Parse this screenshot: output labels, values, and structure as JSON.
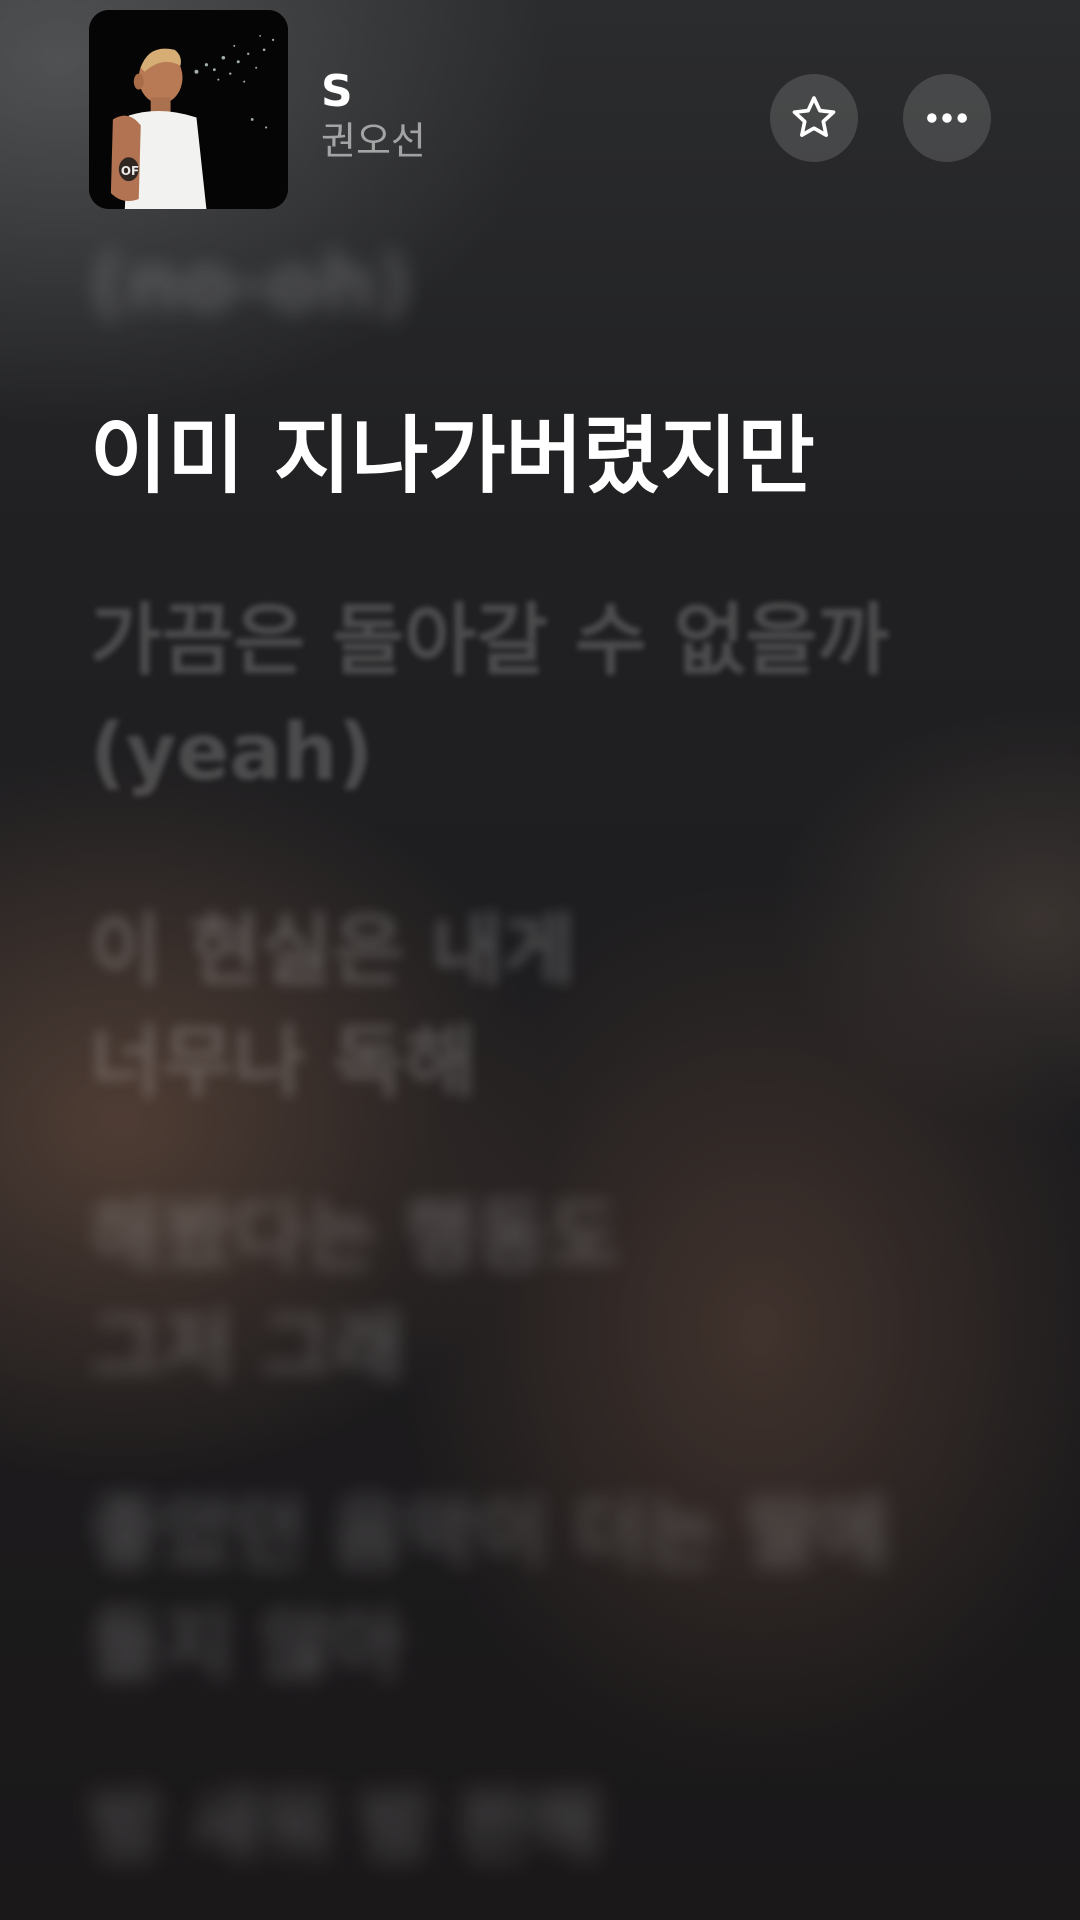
{
  "track": {
    "title": "S",
    "artist": "권오선",
    "album_art_icon": "album-cover-photo"
  },
  "actions": {
    "favorite_icon": "star-icon",
    "more_icon": "more-dots-icon"
  },
  "lyrics": {
    "previous": "(no-oh)",
    "current": "이미 지나가버렸지만",
    "next": [
      "가끔은 돌아갈 수 없을까\n(yeah)",
      "이 현실은 내게\n너무나 독해",
      "해봤다는 행동도\n그저 그래",
      "좋았던 음악이 더는 딸에\n들지 않아",
      "밤 새워 밤 판해"
    ]
  },
  "colors": {
    "active_lyric": "#ffffff",
    "inactive_lyric": "rgba(255,255,255,0.2)",
    "button_bg": "rgba(255,255,255,0.14)"
  }
}
